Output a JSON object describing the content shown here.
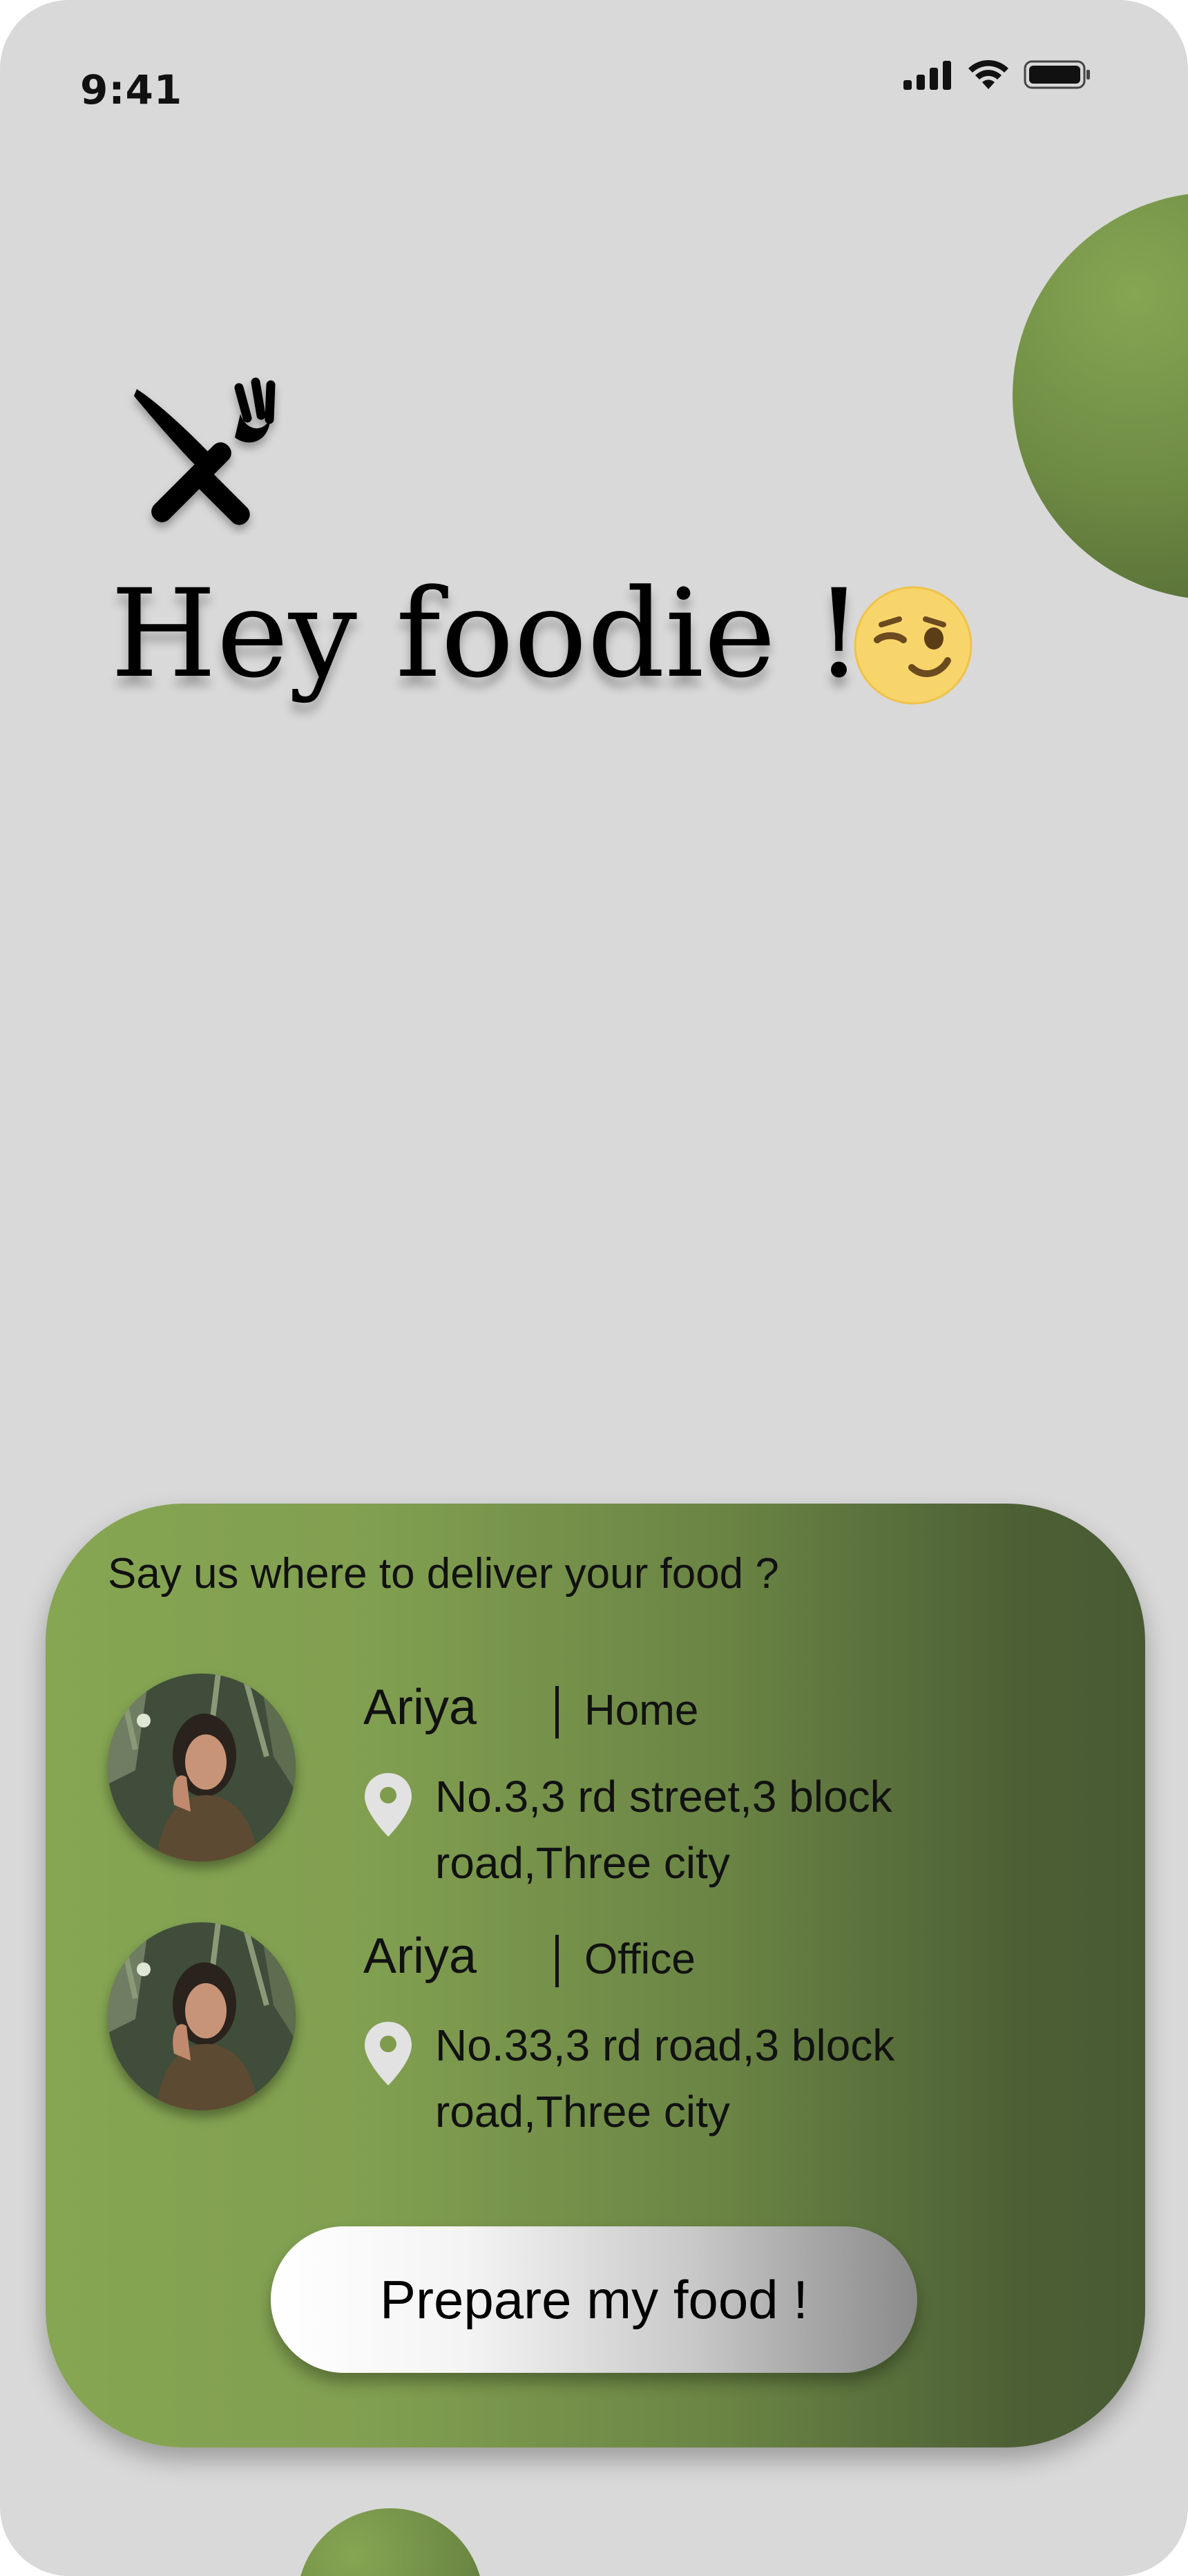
{
  "status_bar": {
    "time": "9:41",
    "icons": [
      "cellular-signal-icon",
      "wifi-icon",
      "battery-icon"
    ]
  },
  "hero": {
    "icon": "fork-knife-icon",
    "greeting": "Hey foodie  !",
    "emoji": "winking-face-icon"
  },
  "delivery_card": {
    "prompt": "Say us where to deliver your food ?",
    "addresses": [
      {
        "name": "Ariya",
        "type": "Home",
        "address": "No.3,3 rd street,3 block road,Three city"
      },
      {
        "name": "Ariya",
        "type": "Office",
        "address": "No.33,3 rd road,3 block road,Three city"
      }
    ],
    "button_label": "Prepare my food !"
  },
  "colors": {
    "background": "#d9d9d9",
    "accent_green": "#86a653",
    "dark_green": "#485a32",
    "emoji_yellow": "#f8d56a"
  }
}
